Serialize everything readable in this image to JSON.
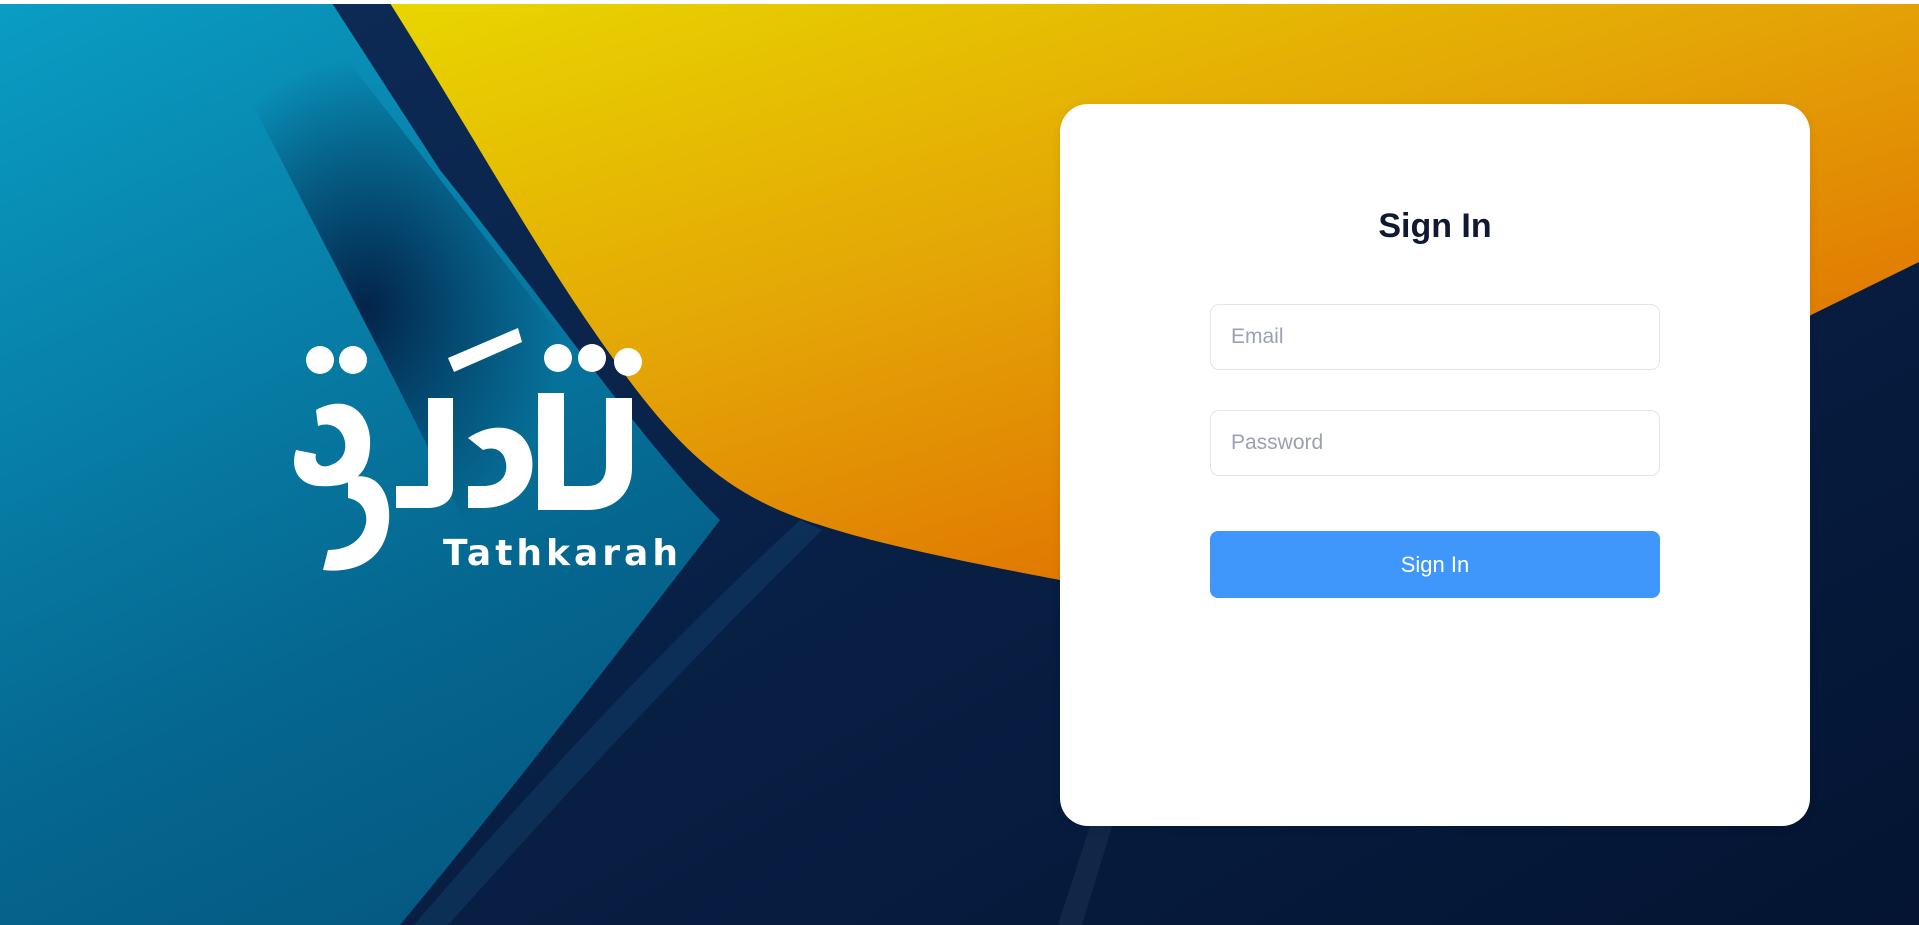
{
  "brand": {
    "logo_arabic": "تذكرة",
    "logo_latin": "Tathkarah"
  },
  "login_form": {
    "title": "Sign In",
    "email_placeholder": "Email",
    "password_placeholder": "Password",
    "submit_label": "Sign In"
  },
  "colors": {
    "primary_button": "#4097fb",
    "title_text": "#111832",
    "background_teal": "#0794b9",
    "background_navy": "#06163a",
    "background_yellow": "#e6cf00",
    "background_orange": "#e06a00"
  }
}
